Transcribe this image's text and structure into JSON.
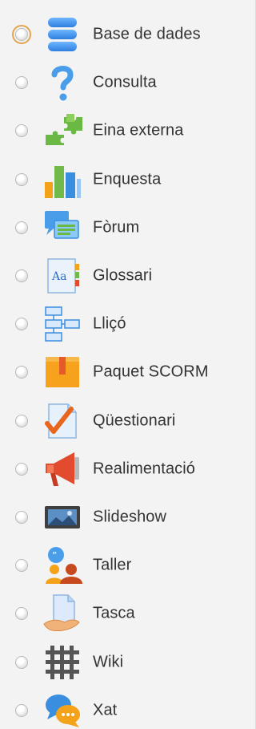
{
  "activities": [
    {
      "label": "Base de dades",
      "icon": "database-icon",
      "focused": true
    },
    {
      "label": "Consulta",
      "icon": "question-icon",
      "focused": false
    },
    {
      "label": "Eina externa",
      "icon": "puzzle-icon",
      "focused": false
    },
    {
      "label": "Enquesta",
      "icon": "bar-chart-icon",
      "focused": false
    },
    {
      "label": "Fòrum",
      "icon": "forum-icon",
      "focused": false
    },
    {
      "label": "Glossari",
      "icon": "glossary-icon",
      "focused": false
    },
    {
      "label": "Lliçó",
      "icon": "lesson-icon",
      "focused": false
    },
    {
      "label": "Paquet SCORM",
      "icon": "package-icon",
      "focused": false
    },
    {
      "label": "Qüestionari",
      "icon": "quiz-icon",
      "focused": false
    },
    {
      "label": "Realimentació",
      "icon": "megaphone-icon",
      "focused": false
    },
    {
      "label": "Slideshow",
      "icon": "slideshow-icon",
      "focused": false
    },
    {
      "label": "Taller",
      "icon": "workshop-icon",
      "focused": false
    },
    {
      "label": "Tasca",
      "icon": "assignment-icon",
      "focused": false
    },
    {
      "label": "Wiki",
      "icon": "wiki-icon",
      "focused": false
    },
    {
      "label": "Xat",
      "icon": "chat-icon",
      "focused": false
    }
  ],
  "colors": {
    "background": "#f3f3f3",
    "text": "#333333",
    "focus": "#e3a44e",
    "blue": "#3b8fe0",
    "green": "#64b03f",
    "orange": "#f39a16",
    "red": "#e24b2e"
  }
}
